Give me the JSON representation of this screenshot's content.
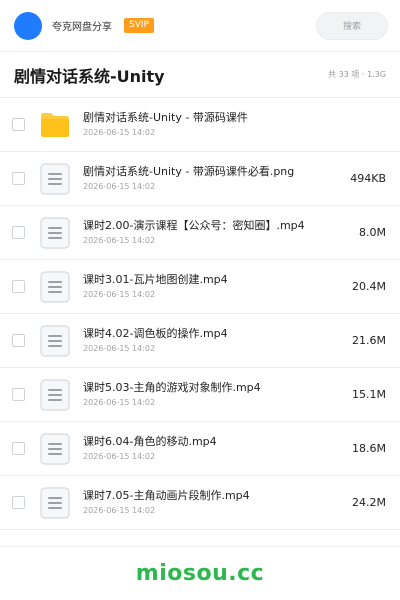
{
  "header": {
    "brand": "夸克网盘分享",
    "badge": "SVIP",
    "search_placeholder": "搜索"
  },
  "folder": {
    "title": "剧情对话系统-Unity",
    "meta": "共 33 项 · 1.3G"
  },
  "files": [
    {
      "name": "剧情对话系统-Unity - 带源码课件",
      "date": "2026-06-15 14:02",
      "size": "",
      "icon": "folder-icon"
    },
    {
      "name": "剧情对话系统-Unity - 带源码课件必看.png",
      "date": "2026-06-15 14:02",
      "size": "494KB",
      "icon": "file-icon"
    },
    {
      "name": "课时2.00-演示课程【公众号：密知圈】.mp4",
      "date": "2026-06-15 14:02",
      "size": "8.0M",
      "icon": "file-icon"
    },
    {
      "name": "课时3.01-瓦片地图创建.mp4",
      "date": "2026-06-15 14:02",
      "size": "20.4M",
      "icon": "file-icon"
    },
    {
      "name": "课时4.02-调色板的操作.mp4",
      "date": "2026-06-15 14:02",
      "size": "21.6M",
      "icon": "file-icon"
    },
    {
      "name": "课时5.03-主角的游戏对象制作.mp4",
      "date": "2026-06-15 14:02",
      "size": "15.1M",
      "icon": "file-icon"
    },
    {
      "name": "课时6.04-角色的移动.mp4",
      "date": "2026-06-15 14:02",
      "size": "18.6M",
      "icon": "file-icon"
    },
    {
      "name": "课时7.05-主角动画片段制作.mp4",
      "date": "2026-06-15 14:02",
      "size": "24.2M",
      "icon": "file-icon"
    }
  ],
  "footer": {
    "watermark": "miosou.cc"
  },
  "colors": {
    "accent": "#1f7bff",
    "svip": "#ff9d1a",
    "folder": "#ffc21a",
    "watermark": "#2db84d"
  }
}
